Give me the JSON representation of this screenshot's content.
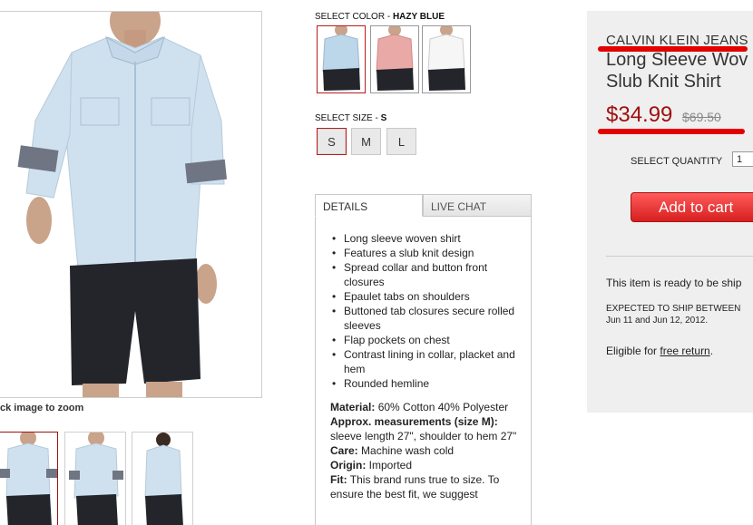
{
  "gallery": {
    "zoom_caption": "ck image to zoom"
  },
  "color": {
    "label": "SELECT COLOR - ",
    "selected": "HAZY BLUE",
    "swatch_colors": [
      "#bcd6ea",
      "#e9a9a7",
      "#f6f6f6"
    ]
  },
  "size": {
    "label": "SELECT SIZE - ",
    "selected": "S",
    "options": [
      "S",
      "M",
      "L"
    ]
  },
  "tabs": {
    "details": "DETAILS",
    "live_chat": "LIVE CHAT"
  },
  "details": {
    "bullets": [
      "Long sleeve woven shirt",
      "Features a slub knit design",
      "Spread collar and button front closures",
      "Epaulet tabs on shoulders",
      "Buttoned tab closures secure rolled sleeves",
      "Flap pockets on chest",
      "Contrast lining in collar, placket and hem",
      "Rounded hemline"
    ],
    "material_label": "Material:",
    "material_value": " 60% Cotton 40% Polyester",
    "measure_label": "Approx. measurements (size M):",
    "measure_value": " sleeve length 27\", shoulder to hem 27\"",
    "care_label": "Care:",
    "care_value": " Machine wash cold",
    "origin_label": "Origin:",
    "origin_value": " Imported",
    "fit_label": "Fit:",
    "fit_value": " This brand runs true to size. To ensure the best fit, we suggest"
  },
  "product": {
    "brand": "CALVIN KLEIN JEANS",
    "title_line1": "Long Sleeve Wov",
    "title_line2": "Slub Knit Shirt",
    "price": "$34.99",
    "old_price": "$69.50",
    "qty_label": "SELECT QUANTITY",
    "qty_value": "1",
    "add_to_cart": "Add to cart",
    "ready": "This item is ready to be ship",
    "ship_line1": "EXPECTED TO SHIP BETWEEN",
    "ship_line2": "Jun 11 and Jun 12, 2012.",
    "eligible_prefix": "Eligible for ",
    "free_return": "free return",
    "eligible_suffix": "."
  },
  "colors": {
    "accent_red": "#a01010",
    "highlight_red": "#e30000",
    "panel_gray": "#efefef"
  }
}
